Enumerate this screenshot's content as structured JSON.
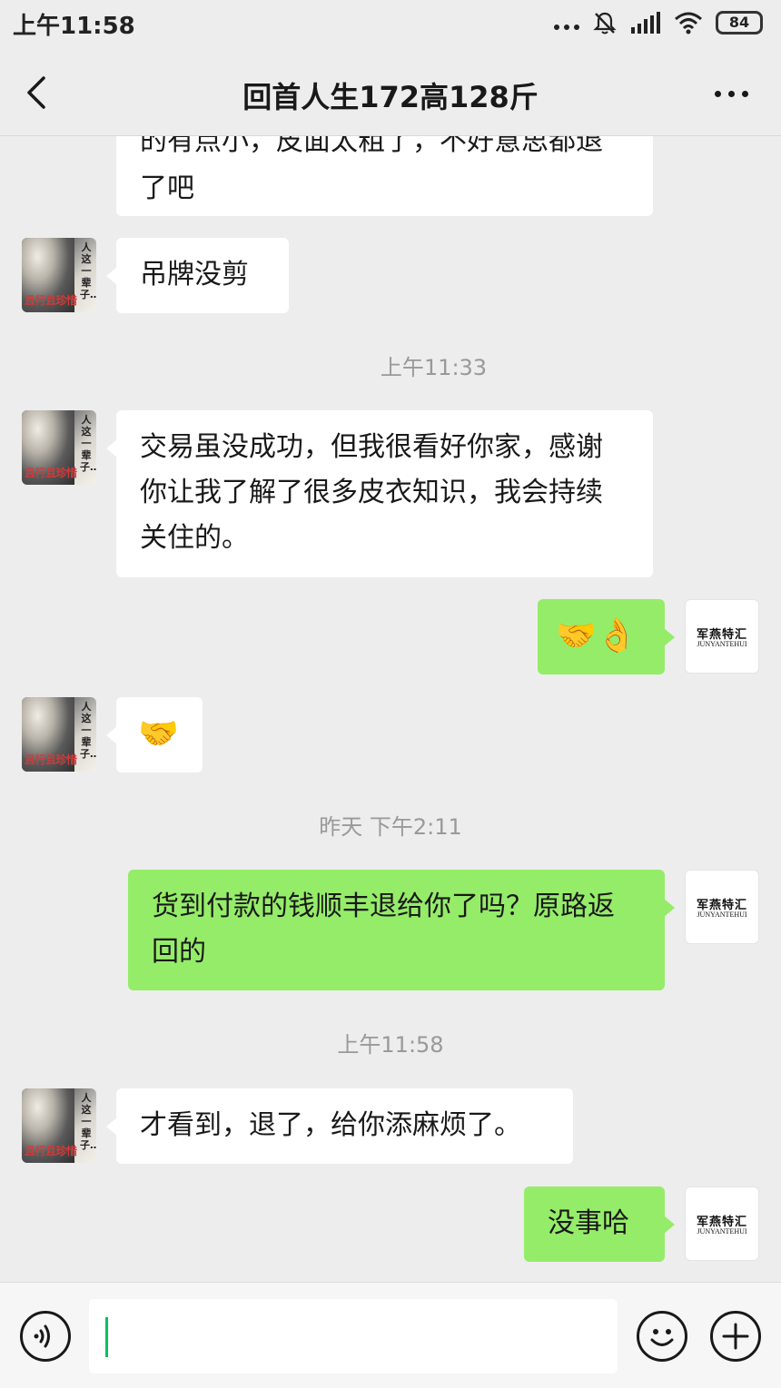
{
  "status_bar": {
    "time": "上午11:58",
    "battery": "84",
    "icons": [
      "more-dots-icon",
      "mute-icon",
      "signal-icon",
      "wifi-icon",
      "battery-icon"
    ]
  },
  "header": {
    "title": "回首人生172高128斤",
    "back_icon": "chevron-left-icon",
    "more_icon": "more-dots-icon"
  },
  "avatars": {
    "contact": {
      "vertical_text": "人这一辈子…",
      "bottom_text": "且行且珍惜"
    },
    "me": {
      "logo_cn": "军燕特汇",
      "logo_en": "JUNYANTEHUI"
    }
  },
  "messages": [
    {
      "side": "left",
      "text": "的有点小，皮面太粗了，不好意思都退了吧",
      "partial": true
    },
    {
      "side": "left",
      "text": "吊牌没剪"
    },
    {
      "type": "timestamp",
      "text": "上午11:33"
    },
    {
      "side": "left",
      "text": "交易虽没成功，但我很看好你家，感谢你让我了解了很多皮衣知识，我会持续关住的。"
    },
    {
      "side": "right",
      "text": "🤝👌"
    },
    {
      "side": "left",
      "text": "🤝"
    },
    {
      "type": "timestamp",
      "text": "昨天 下午2:11"
    },
    {
      "side": "right",
      "text": "货到付款的钱顺丰退给你了吗？原路返回的"
    },
    {
      "type": "timestamp",
      "text": "上午11:58"
    },
    {
      "side": "left",
      "text": "才看到，退了，给你添麻烦了。"
    },
    {
      "side": "right",
      "text": "没事哈"
    }
  ],
  "input_bar": {
    "value": "",
    "voice_icon": "voice-icon",
    "emoji_icon": "emoji-icon",
    "plus_icon": "plus-icon"
  },
  "colors": {
    "background": "#ededed",
    "my_bubble": "#95ec69",
    "their_bubble": "#ffffff",
    "timestamp": "#999999",
    "caret": "#07c160"
  }
}
